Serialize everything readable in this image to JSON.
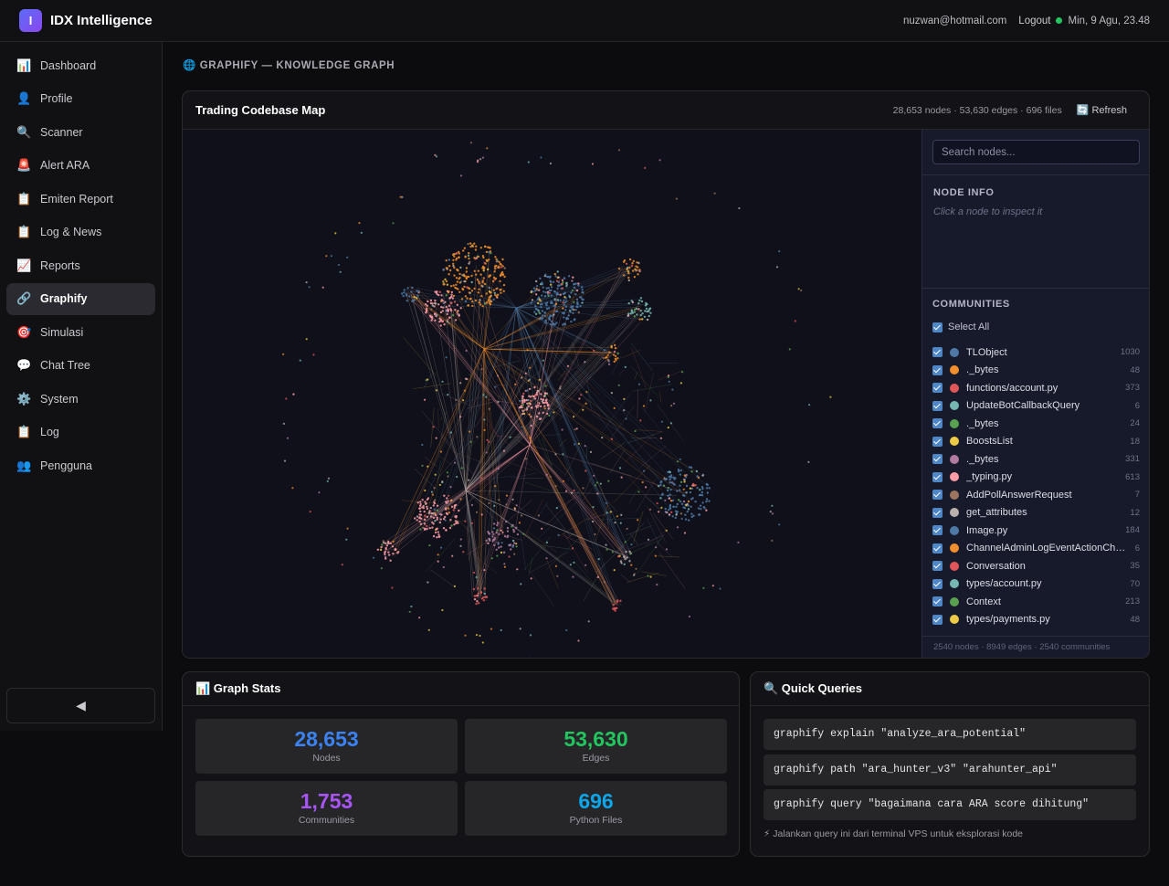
{
  "app": {
    "logo_letter": "I",
    "title": "IDX Intelligence"
  },
  "topbar": {
    "email": "nuzwan@hotmail.com",
    "logout": "Logout",
    "datetime": "Min, 9 Agu, 23.48",
    "status_color": "#22c55e"
  },
  "sidebar": {
    "items": [
      {
        "icon": "📊",
        "icon_name": "bar-chart-icon",
        "label": "Dashboard"
      },
      {
        "icon": "👤",
        "icon_name": "user-icon",
        "label": "Profile"
      },
      {
        "icon": "🔍",
        "icon_name": "search-icon",
        "label": "Scanner"
      },
      {
        "icon": "🚨",
        "icon_name": "siren-icon",
        "label": "Alert ARA"
      },
      {
        "icon": "📋",
        "icon_name": "clipboard-icon",
        "label": "Emiten Report"
      },
      {
        "icon": "📋",
        "icon_name": "clipboard-icon",
        "label": "Log & News"
      },
      {
        "icon": "📈",
        "icon_name": "trend-chart-icon",
        "label": "Reports"
      },
      {
        "icon": "🔗",
        "icon_name": "link-icon",
        "label": "Graphify",
        "active": true
      },
      {
        "icon": "🎯",
        "icon_name": "target-icon",
        "label": "Simulasi"
      },
      {
        "icon": "💬",
        "icon_name": "chat-icon",
        "label": "Chat Tree"
      },
      {
        "icon": "⚙️",
        "icon_name": "gear-icon",
        "label": "System"
      },
      {
        "icon": "📋",
        "icon_name": "clipboard-icon",
        "label": "Log"
      },
      {
        "icon": "👥",
        "icon_name": "users-icon",
        "label": "Pengguna"
      }
    ],
    "collapse_label": "◀"
  },
  "page": {
    "heading": "🌐 GRAPHIFY — KNOWLEDGE GRAPH"
  },
  "graph": {
    "title": "Trading Codebase Map",
    "summary": "28,653 nodes · 53,630 edges · 696 files",
    "refresh_label": "🔄 Refresh",
    "search_placeholder": "Search nodes...",
    "node_info_title": "NODE INFO",
    "node_info_hint": "Click a node to inspect it",
    "communities_title": "COMMUNITIES",
    "select_all": "Select All",
    "communities": [
      {
        "name": "TLObject",
        "count": "1030",
        "color": "#4e79a7"
      },
      {
        "name": "._bytes",
        "count": "48",
        "color": "#f28e2b"
      },
      {
        "name": "functions/account.py",
        "count": "373",
        "color": "#e15759"
      },
      {
        "name": "UpdateBotCallbackQuery",
        "count": "6",
        "color": "#76b7b2"
      },
      {
        "name": "._bytes",
        "count": "24",
        "color": "#59a14f"
      },
      {
        "name": "BoostsList",
        "count": "18",
        "color": "#edc948"
      },
      {
        "name": "._bytes",
        "count": "331",
        "color": "#b07aa1"
      },
      {
        "name": "_typing.py",
        "count": "613",
        "color": "#ff9da7"
      },
      {
        "name": "AddPollAnswerRequest",
        "count": "7",
        "color": "#9c755f"
      },
      {
        "name": "get_attributes",
        "count": "12",
        "color": "#bab0ac"
      },
      {
        "name": "Image.py",
        "count": "184",
        "color": "#4e79a7"
      },
      {
        "name": "ChannelAdminLogEventActionCha…",
        "count": "6",
        "color": "#f28e2b"
      },
      {
        "name": "Conversation",
        "count": "35",
        "color": "#e15759"
      },
      {
        "name": "types/account.py",
        "count": "70",
        "color": "#76b7b2"
      },
      {
        "name": "Context",
        "count": "213",
        "color": "#59a14f"
      },
      {
        "name": "types/payments.py",
        "count": "48",
        "color": "#edc948"
      }
    ],
    "footer": "2540 nodes · 8949 edges · 2540 communities"
  },
  "stats": {
    "title": "📊 Graph Stats",
    "items": [
      {
        "value": "28,653",
        "label": "Nodes",
        "color": "#3b82f6"
      },
      {
        "value": "53,630",
        "label": "Edges",
        "color": "#22c55e"
      },
      {
        "value": "1,753",
        "label": "Communities",
        "color": "#a855f7"
      },
      {
        "value": "696",
        "label": "Python Files",
        "color": "#0ea5e9"
      }
    ]
  },
  "queries": {
    "title": "🔍 Quick Queries",
    "items": [
      "graphify explain \"analyze_ara_potential\"",
      "graphify path \"ara_hunter_v3\" \"arahunter_api\"",
      "graphify query \"bagaimana cara ARA score dihitung\""
    ],
    "note": "⚡ Jalankan query ini dari terminal VPS untuk eksplorasi kode"
  }
}
